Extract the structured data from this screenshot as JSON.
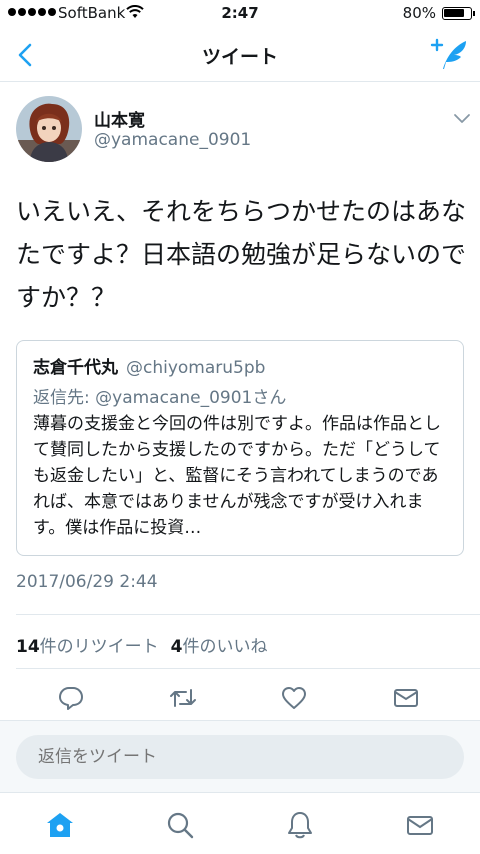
{
  "status_bar": {
    "carrier": "SoftBank",
    "time": "2:47",
    "battery": "80%",
    "battery_level": 0.8
  },
  "nav": {
    "title": "ツイート",
    "back_icon": "chevron-left-icon",
    "compose_icon": "compose-tweet-icon"
  },
  "colors": {
    "accent": "#1da1f2",
    "secondary_text": "#657786",
    "border": "#e1e8ed"
  },
  "tweet": {
    "author_name": "山本寛",
    "author_handle": "@yamacane_0901",
    "text": "いえいえ、それをちらつかせたのはあなたですよ？日本語の勉強が足らないのですか？？",
    "timestamp": "2017/06/29 2:44",
    "retweet_count": "14",
    "retweet_label": "件のリツイート",
    "like_count": "4",
    "like_label": "件のいいね"
  },
  "quoted_tweet": {
    "author_name": "志倉千代丸",
    "author_handle": "@chiyomaru5pb",
    "reply_prefix": "返信先: ",
    "reply_to": "@yamacane_0901さん",
    "text": "薄暮の支援金と今回の件は別ですよ。作品は作品として賛同したから支援したのですから。ただ「どうしても返金したい」と、監督にそう言われてしまうのであれば、本意ではありませんが残念ですが受け入れます。僕は作品に投資…"
  },
  "actions": [
    "reply-icon",
    "retweet-icon",
    "like-icon",
    "share-dm-icon"
  ],
  "reply_box": {
    "placeholder": "返信をツイート"
  },
  "tab_bar": [
    "home-icon",
    "search-icon",
    "notifications-icon",
    "messages-icon"
  ]
}
